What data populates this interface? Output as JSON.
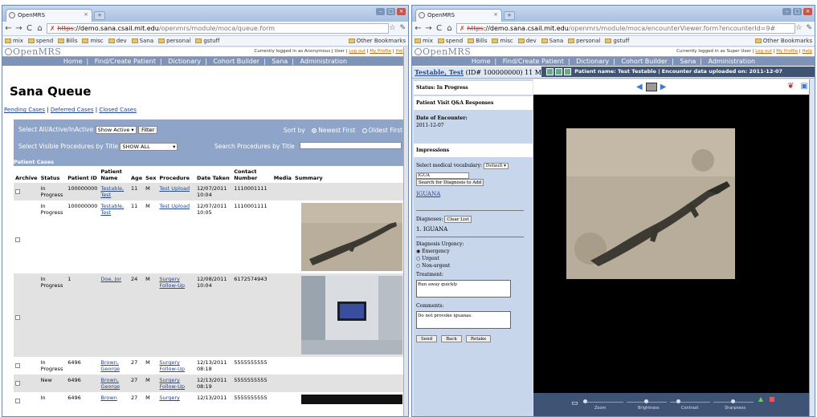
{
  "window_left": {
    "tab_title": "OpenMRS",
    "url_scheme": "https",
    "url_rest_domain": "://demo.sana.csail.mit.edu",
    "url_path": "/openmrs/module/moca/queue.form",
    "bookmarks": [
      "mix",
      "spend",
      "Bills",
      "misc",
      "dev",
      "Sana",
      "personal",
      "gstuff"
    ],
    "other_bookmarks": "Other Bookmarks",
    "logo": "OpenMRS",
    "logged_in_text": "Currently logged in as Anonymous J User |",
    "logout": "Log out",
    "my_profile": "My Profile",
    "help": "Help",
    "nav": [
      "Home",
      "Find/Create Patient",
      "Dictionary",
      "Cohort Builder",
      "Sana",
      "Administration"
    ],
    "page_title": "Sana Queue",
    "sub_links": [
      "Pending Cases",
      "Deferred Cases",
      "Closed Cases"
    ],
    "filter": {
      "select_label": "Select All/Active/InActive",
      "select_value": "Show Active",
      "filter_button": "Filter",
      "sort_label": "Sort by",
      "sort_newest": "Newest First",
      "sort_oldest": "Oldest First",
      "procedures_label": "Select Visible Procedures by Title",
      "procedures_value": "SHOW ALL",
      "search_label": "Search Procedures by Title"
    },
    "cases_header": "Patient Cases",
    "columns": [
      "Archive",
      "Status",
      "Patient ID",
      "Patient Name",
      "Age",
      "Sex",
      "Procedure",
      "Date Taken",
      "Contact Number",
      "Media",
      "Summary"
    ],
    "rows": [
      {
        "status": "In Progress",
        "pid": "100000000",
        "name": "Testable, Test",
        "age": "11",
        "sex": "M",
        "procedure": "Test Upload",
        "date": "12/07/2011 10:04",
        "contact": "1110001111",
        "photo": ""
      },
      {
        "status": "In Progress",
        "pid": "100000000",
        "name": "Testable, Test",
        "age": "11",
        "sex": "M",
        "procedure": "Test Upload",
        "date": "12/07/2011 10:05",
        "contact": "1110001111",
        "photo": "iguana"
      },
      {
        "status": "In Progress",
        "pid": "1",
        "name": "Doe, Jor",
        "age": "24",
        "sex": "M",
        "procedure": "Surgery Follow-Up",
        "date": "12/08/2011 10:04",
        "contact": "6172574943",
        "photo": "room"
      },
      {
        "status": "In Progress",
        "pid": "6496",
        "name": "Brown, George",
        "age": "27",
        "sex": "M",
        "procedure": "Surgery Follow-Up",
        "date": "12/13/2011 08:18",
        "contact": "5555555555",
        "photo": ""
      },
      {
        "status": "New",
        "pid": "6496",
        "name": "Brown, George",
        "age": "27",
        "sex": "M",
        "procedure": "Surgery Follow-Up",
        "date": "12/13/2011 08:19",
        "contact": "5555555555",
        "photo": ""
      },
      {
        "status": "In",
        "pid": "6496",
        "name": "Brown",
        "age": "27",
        "sex": "M",
        "procedure": "Surgery",
        "date": "12/13/2011",
        "contact": "5555555555",
        "photo": "dark"
      }
    ]
  },
  "window_right": {
    "tab_title": "OpenMRS",
    "url_scheme": "https",
    "url_rest_domain": "://demo.sana.csail.mit.edu",
    "url_path": "/openmrs/module/moca/encounterViewer.form?encounterId=9#",
    "logged_in_text": "Currently logged in as Super User |",
    "patient_name_link": "Testable, Test",
    "patient_id_text": "(ID# 100000000) 11 M",
    "meta_text": "Patient name: Test Testable   |   Encounter data uploaded on: 2011-12-07",
    "status": "Status: In Progress",
    "qa_header": "Patient Visit Q&A Responses",
    "date_label": "Date of Encounter:",
    "date_value": "2011-12-07",
    "impressions": "Impressions",
    "vocab_label": "Select medical vocabulary:",
    "vocab_value": "Default",
    "search_value": "IGUA",
    "search_button": "Search for Diagnosis to Add",
    "search_result": "IGUANA",
    "diagnoses_label": "Diagnoses:",
    "clear_button": "Clear List",
    "diagnosis_1": "1. IGUANA",
    "urgency_label": "Diagnosis Urgency:",
    "urgency_options": [
      "Emergency",
      "Urgent",
      "Non-urgent"
    ],
    "treatment_label": "Treatment:",
    "treatment_value": "Run away quickly",
    "comments_label": "Comments:",
    "comments_value": "Do not provoke iguanas.",
    "buttons": [
      "Send",
      "Back",
      "Retake"
    ],
    "sliders": [
      "Zoom",
      "Brightness",
      "Contrast",
      "Sharpness"
    ]
  },
  "colors": {
    "filter_bg": "#8ea5c9",
    "nav_bg": "#7e93b8",
    "link": "#23479b",
    "meta_bg": "#3f5474"
  }
}
